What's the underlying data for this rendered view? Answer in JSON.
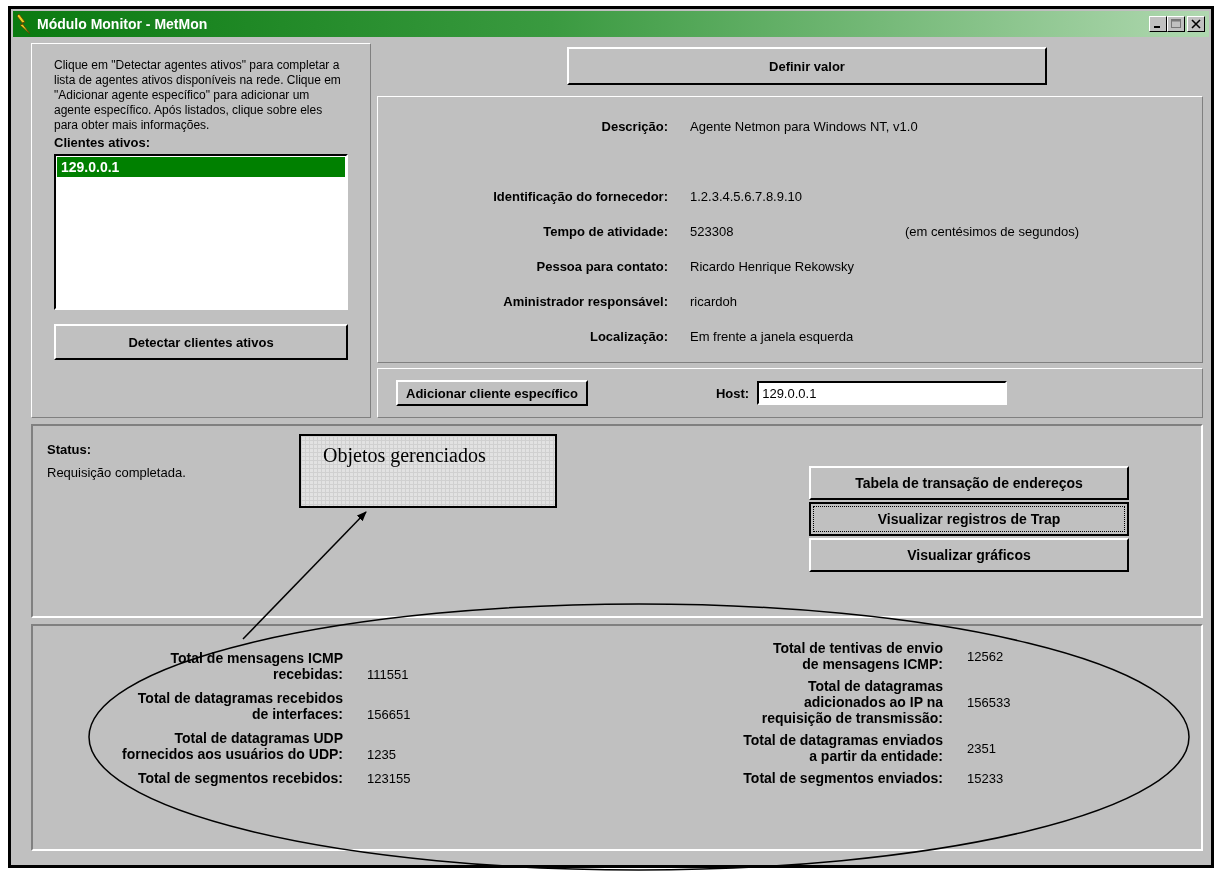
{
  "window": {
    "title": "Módulo Monitor - MetMon"
  },
  "instructions": "Clique em \"Detectar agentes ativos\" para completar a lista de agentes ativos disponíveis na rede. Clique em \"Adicionar agente específico\" para adicionar um agente específico. Após listados, clique sobre eles para obter mais informações.",
  "clients": {
    "label": "Clientes ativos:",
    "items": [
      {
        "text": "129.0.0.1",
        "selected": true
      }
    ]
  },
  "detect_button": "Detectar clientes ativos",
  "set_value_button": "Definir valor",
  "details": [
    {
      "label": "Descrição:",
      "value": "Agente Netmon para Windows NT, v1.0"
    },
    {
      "label": "Identificação do fornecedor:",
      "value": "1.2.3.4.5.6.7.8.9.10"
    },
    {
      "label": "Tempo de atividade:",
      "value": "523308",
      "note": "(em centésimos de segundos)"
    },
    {
      "label": "Pessoa para contato:",
      "value": "Ricardo Henrique Rekowsky"
    },
    {
      "label": "Aministrador responsável:",
      "value": "ricardoh"
    },
    {
      "label": "Localização:",
      "value": "Em frente a janela esquerda"
    }
  ],
  "add_button": "Adicionar cliente específico",
  "host": {
    "label": "Host:",
    "value": "129.0.0.1"
  },
  "status": {
    "label": "Status:",
    "text": "Requisição completada."
  },
  "action_buttons": [
    {
      "label": "Tabela de transação de endereços",
      "focused": false
    },
    {
      "label": "Visualizar registros de Trap",
      "focused": true
    },
    {
      "label": "Visualizar gráficos",
      "focused": false
    }
  ],
  "stats_left": [
    {
      "label": "Total de mensagens ICMP\nrecebidas:",
      "value": "111551"
    },
    {
      "label": "Total de datagramas recebidos\nde interfaces:",
      "value": "156651"
    },
    {
      "label": "Total de datagramas UDP\nfornecidos aos usuários do UDP:",
      "value": "1235"
    },
    {
      "label": "Total de segmentos recebidos:",
      "value": "123155"
    }
  ],
  "stats_right": [
    {
      "label": "Total de tentivas de envio\nde mensagens ICMP:",
      "value": "12562"
    },
    {
      "label": "Total de datagramas\nadicionados ao IP na\nrequisição de transmissão:",
      "value": "156533"
    },
    {
      "label": "Total de datagramas enviados\na partir da entidade:",
      "value": "2351"
    },
    {
      "label": "Total de segmentos enviados:",
      "value": "15233"
    }
  ],
  "annotation": {
    "label": "Objetos gerenciados"
  }
}
